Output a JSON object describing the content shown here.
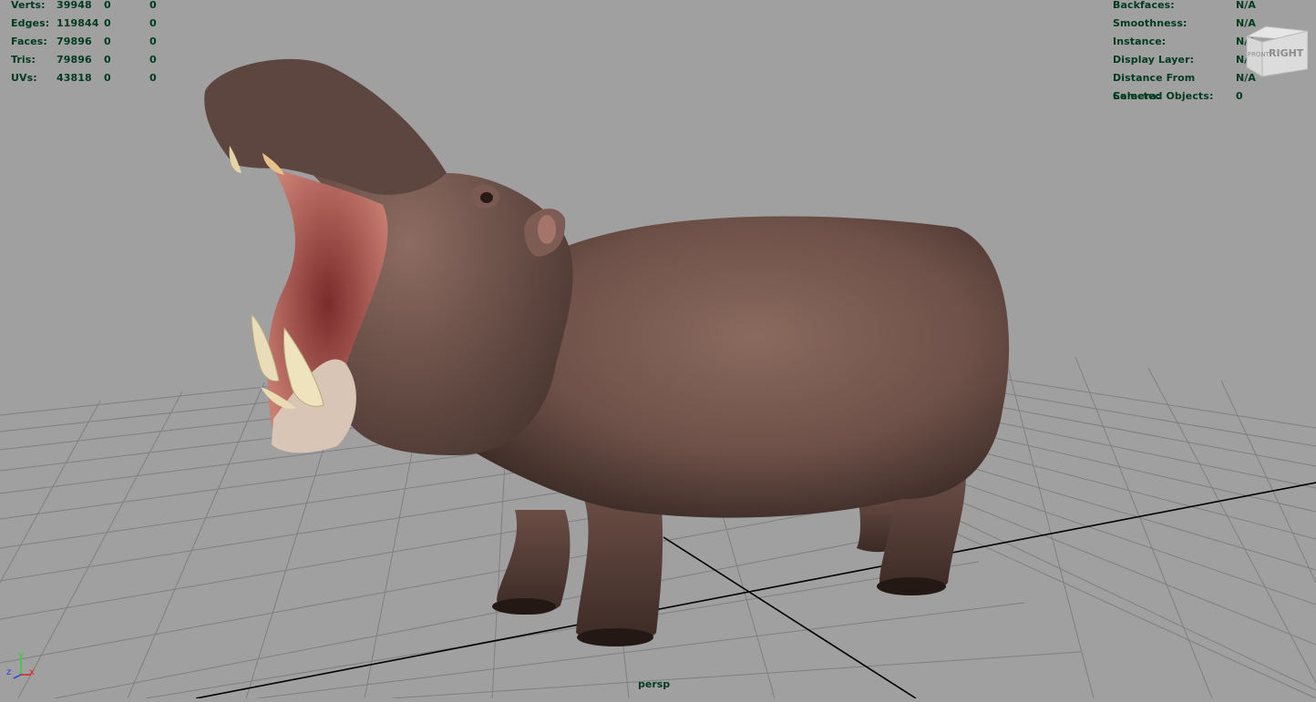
{
  "viewport": {
    "camera": "persp",
    "background": "#a0a0a0"
  },
  "hud_left": {
    "rows": [
      {
        "label": "Verts:",
        "values": [
          "39948",
          "0",
          "0"
        ]
      },
      {
        "label": "Edges:",
        "values": [
          "119844",
          "0",
          "0"
        ]
      },
      {
        "label": "Faces:",
        "values": [
          "79896",
          "0",
          "0"
        ]
      },
      {
        "label": "Tris:",
        "values": [
          "79896",
          "0",
          "0"
        ]
      },
      {
        "label": "UVs:",
        "values": [
          "43818",
          "0",
          "0"
        ]
      }
    ]
  },
  "hud_right": {
    "rows": [
      {
        "label": "Backfaces:",
        "value": "N/A"
      },
      {
        "label": "Smoothness:",
        "value": "N/A"
      },
      {
        "label": "Instance:",
        "value": "N/A"
      },
      {
        "label": "Display Layer:",
        "value": "N/A"
      },
      {
        "label": "Distance From Camera:",
        "value": "N/A"
      },
      {
        "label": "Selected Objects:",
        "value": "0"
      }
    ]
  },
  "viewcube": {
    "face_label": "RIGHT",
    "side_label": "FRONT"
  },
  "axis_gizmo": {
    "x": "x",
    "y": "y",
    "z": "z"
  },
  "colors": {
    "hud_text": "#003a1f",
    "grid": "#7f7f7f",
    "axis": "#000000"
  }
}
